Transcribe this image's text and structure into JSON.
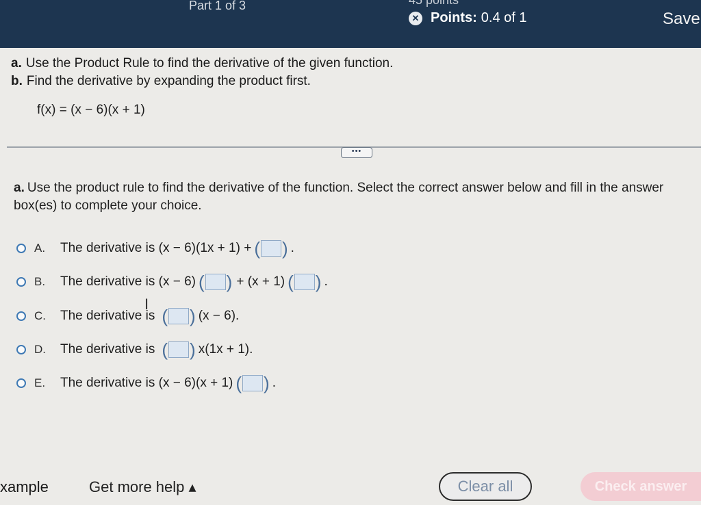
{
  "header": {
    "part": "Part 1 of 3",
    "points_cut": "45 points",
    "points_label": "Points:",
    "points_value": "0.4 of 1",
    "save_label": "Save"
  },
  "question": {
    "part_a_letter": "a.",
    "part_a": "Use the Product Rule to find the derivative of the given function.",
    "part_b_letter": "b.",
    "part_b": "Find the derivative by expanding the product first.",
    "function": "f(x) = (x − 6)(x + 1)"
  },
  "expand_button": "•••",
  "instruction": {
    "letter": "a.",
    "text": "Use the product rule to find the derivative of the function. Select the correct answer below and fill in the answer box(es) to complete your choice."
  },
  "choices": [
    {
      "letter": "A.",
      "text": "The derivative is (x − 6)(1x + 1) +",
      "suffix": "."
    },
    {
      "letter": "B.",
      "text": "The derivative is (x − 6)",
      "middle": "+ (x + 1)",
      "suffix": "."
    },
    {
      "letter": "C.",
      "text": "The derivative is",
      "suffix": "(x − 6)."
    },
    {
      "letter": "D.",
      "text": "The derivative is",
      "suffix": "x(1x + 1)."
    },
    {
      "letter": "E.",
      "text": "The derivative is (x − 6)(x + 1)",
      "suffix": "."
    }
  ],
  "footer": {
    "example": "xample",
    "help": "Get more help ▴",
    "clear_all": "Clear all",
    "check_answer": "Check answer"
  }
}
